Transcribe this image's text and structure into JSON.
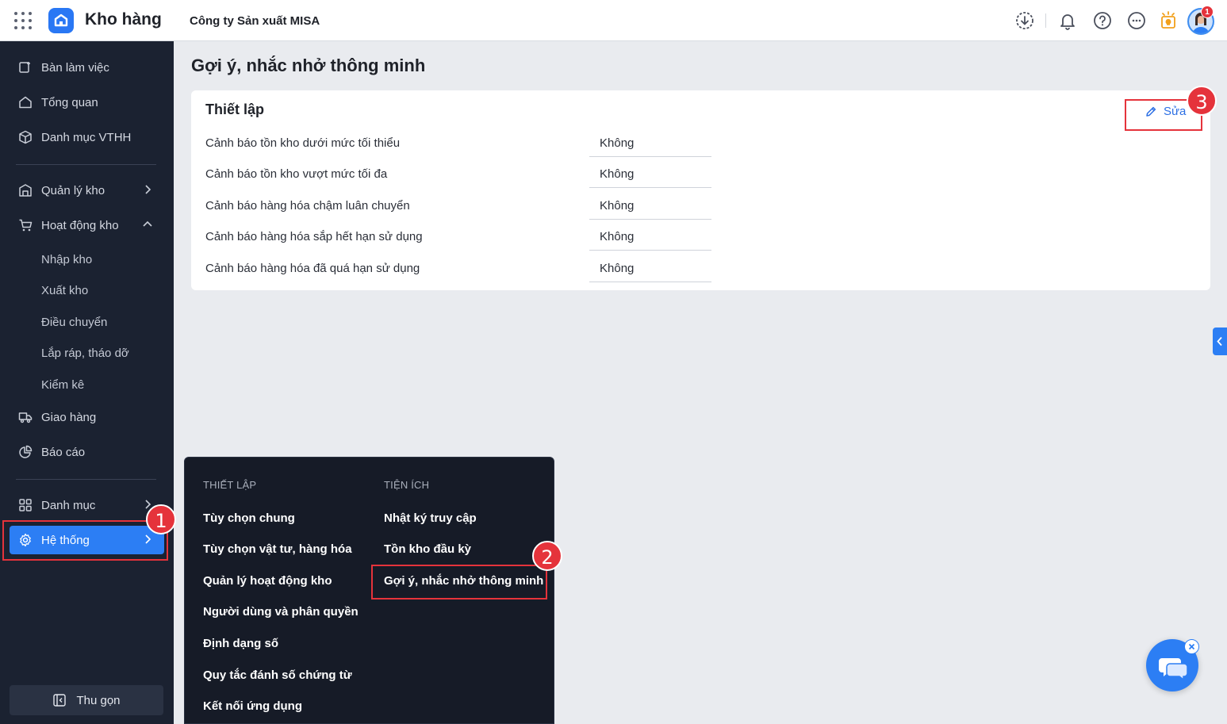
{
  "header": {
    "app_name": "Kho hàng",
    "company": "Công ty Sản xuất MISA",
    "notification_count": "1",
    "icons": [
      "apps-grid-icon",
      "download-icon",
      "bell-icon",
      "help-icon",
      "more-icon",
      "lightbulb-icon"
    ]
  },
  "sidebar": {
    "items": [
      {
        "label": "Bàn làm việc",
        "icon": "desk-icon"
      },
      {
        "label": "Tổng quan",
        "icon": "home-icon"
      },
      {
        "label": "Danh mục VTHH",
        "icon": "box-icon"
      },
      {
        "label": "Quản lý kho",
        "icon": "warehouse-icon"
      },
      {
        "label": "Hoạt động kho",
        "icon": "cart-icon"
      },
      {
        "label": "Giao hàng",
        "icon": "truck-icon"
      },
      {
        "label": "Báo cáo",
        "icon": "pie-chart-icon"
      },
      {
        "label": "Danh mục",
        "icon": "grid-icon"
      },
      {
        "label": "Hệ thống",
        "icon": "gear-icon"
      }
    ],
    "sub_items": [
      "Nhập kho",
      "Xuất kho",
      "Điều chuyển",
      "Lắp ráp, tháo dỡ",
      "Kiểm kê"
    ],
    "collapse_label": "Thu gọn"
  },
  "main": {
    "page_title": "Gợi ý, nhắc nhở thông minh",
    "card_title": "Thiết lập",
    "edit_label": "Sửa",
    "rows": [
      {
        "label": "Cảnh báo tồn kho dưới mức tối thiểu",
        "value": "Không"
      },
      {
        "label": "Cảnh báo tồn kho vượt mức tối đa",
        "value": "Không"
      },
      {
        "label": "Cảnh báo hàng hóa chậm luân chuyển",
        "value": "Không"
      },
      {
        "label": "Cảnh báo hàng hóa sắp hết hạn sử dụng",
        "value": "Không"
      },
      {
        "label": "Cảnh báo hàng hóa đã quá hạn sử dụng",
        "value": "Không"
      }
    ]
  },
  "menu": {
    "col1_title": "THIẾT LẬP",
    "col1_items": [
      "Tùy chọn chung",
      "Tùy chọn vật tư, hàng hóa",
      "Quản lý hoạt động kho",
      "Người dùng và phân quyền",
      "Định dạng số",
      "Quy tắc đánh số chứng từ",
      "Kết nối ứng dụng"
    ],
    "col2_title": "TIỆN ÍCH",
    "col2_items": [
      "Nhật ký truy cập",
      "Tồn kho đầu kỳ",
      "Gợi ý, nhắc nhở thông minh"
    ]
  },
  "annotations": {
    "marker1": "1",
    "marker2": "2",
    "marker3": "3"
  },
  "colors": {
    "accent": "#2c7ef4",
    "sidebar_bg": "#1b2231",
    "highlight": "#e5333b"
  }
}
